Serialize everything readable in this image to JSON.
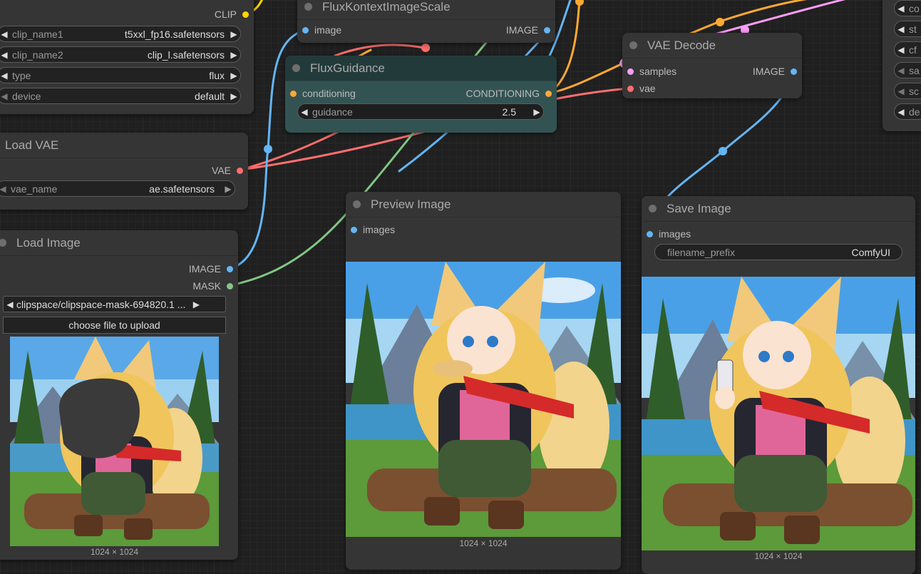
{
  "colors": {
    "clip": "#ffd500",
    "image": "#64b5f6",
    "vae": "#ff6e6e",
    "mask": "#81c784",
    "conditioning": "#ffa931",
    "latent": "#ff9cf9",
    "guidance_node_bg": "#335353"
  },
  "dual_clip": {
    "output_clip": "CLIP",
    "widgets": [
      {
        "label": "clip_name1",
        "value": "t5xxl_fp16.safetensors"
      },
      {
        "label": "clip_name2",
        "value": "clip_l.safetensors"
      },
      {
        "label": "type",
        "value": "flux"
      },
      {
        "label": "device",
        "value": "default"
      }
    ]
  },
  "flux_kontext_scale": {
    "title": "FluxKontextImageScale",
    "input_image": "image",
    "output_image": "IMAGE"
  },
  "flux_guidance": {
    "title": "FluxGuidance",
    "input_conditioning": "conditioning",
    "output_conditioning": "CONDITIONING",
    "guidance_label": "guidance",
    "guidance_value": "2.5"
  },
  "vae_decode": {
    "title": "VAE Decode",
    "input_samples": "samples",
    "input_vae": "vae",
    "output_image": "IMAGE"
  },
  "ksampler_partial": {
    "labels": [
      "co",
      "st",
      "cf",
      "sa",
      "sc",
      "de"
    ]
  },
  "load_vae": {
    "title": "Load VAE",
    "output_vae": "VAE",
    "widget_label": "vae_name",
    "widget_value": "ae.safetensors"
  },
  "load_image": {
    "title": "Load Image",
    "output_image": "IMAGE",
    "output_mask": "MASK",
    "file_value": "clipspace/clipspace-mask-694820.1 ...",
    "upload_label": "choose file to upload",
    "image_size": "1024 × 1024"
  },
  "preview_image": {
    "title": "Preview Image",
    "input_images": "images",
    "image_size": "1024 × 1024"
  },
  "save_image": {
    "title": "Save Image",
    "input_images": "images",
    "prefix_label": "filename_prefix",
    "prefix_value": "ComfyUI",
    "image_size": "1024 × 1024"
  },
  "icons": {
    "arrow_left": "◀",
    "arrow_right": "▶"
  }
}
